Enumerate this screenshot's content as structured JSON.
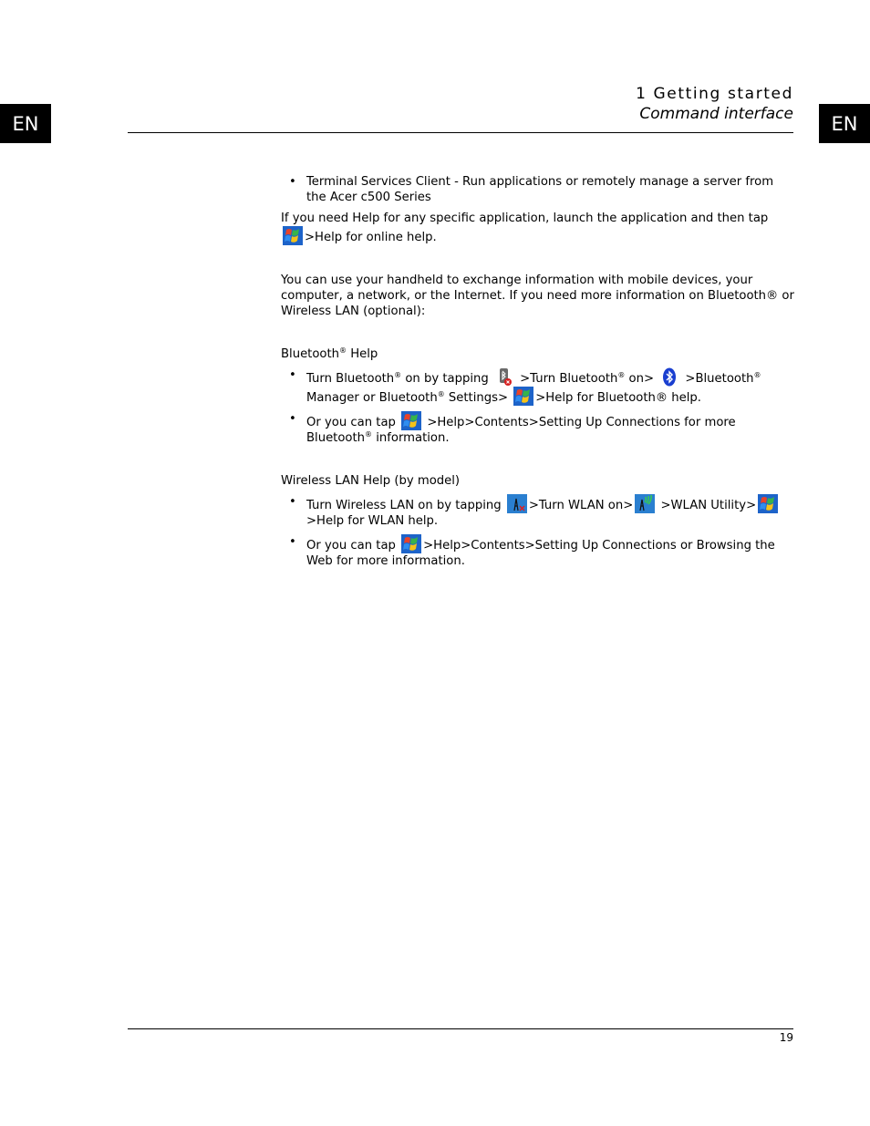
{
  "language_tab": "EN",
  "header": {
    "chapter": "1 Getting started",
    "section": "Command interface"
  },
  "content": {
    "terminal_bullet": "Terminal Services Client - Run applications or remotely manage a server from the Acer c500 Series",
    "help_para": {
      "before": "If you need Help for any specific application, launch the application and then tap",
      "after": ">Help for online help."
    },
    "connect_para": "You can use your handheld to exchange information with mobile devices, your computer, a network, or the Internet. If you need more information on Bluetooth® or Wireless LAN (optional):",
    "bluetooth": {
      "heading": "Bluetooth",
      "heading_sup": "®",
      "heading_after": " Help",
      "bullet1": {
        "t1": "Turn Bluetooth",
        "t2": " on by tapping ",
        "t3": " >Turn Bluetooth",
        "t4": " on> ",
        "t5": " >Bluetooth",
        "t6": " Manager or Bluetooth",
        "t7": " Settings> ",
        "t8": ">Help for Bluetooth® help."
      },
      "bullet2": {
        "t1": "Or you can tap ",
        "t2": " >Help>Contents>Setting Up Connections for more Bluetooth",
        "t3": " information."
      },
      "reg": "®"
    },
    "wlan": {
      "heading": "Wireless LAN Help (by model)",
      "bullet1": {
        "t1": "Turn Wireless LAN on by tapping ",
        "t2": ">Turn WLAN on>",
        "t3": " >WLAN Utility>",
        "t4": ">Help for WLAN help."
      },
      "bullet2": {
        "t1": "Or you can tap ",
        "t2": ">Help>Contents>Setting Up Connections or Browsing the Web for more information."
      }
    },
    "icons": {
      "start": "windows-start-icon",
      "bt_off": "bluetooth-off-icon",
      "bt_on": "bluetooth-icon",
      "wlan_off": "wlan-off-icon",
      "wlan_on": "wlan-on-icon"
    }
  },
  "footer": {
    "page_number": "19"
  }
}
